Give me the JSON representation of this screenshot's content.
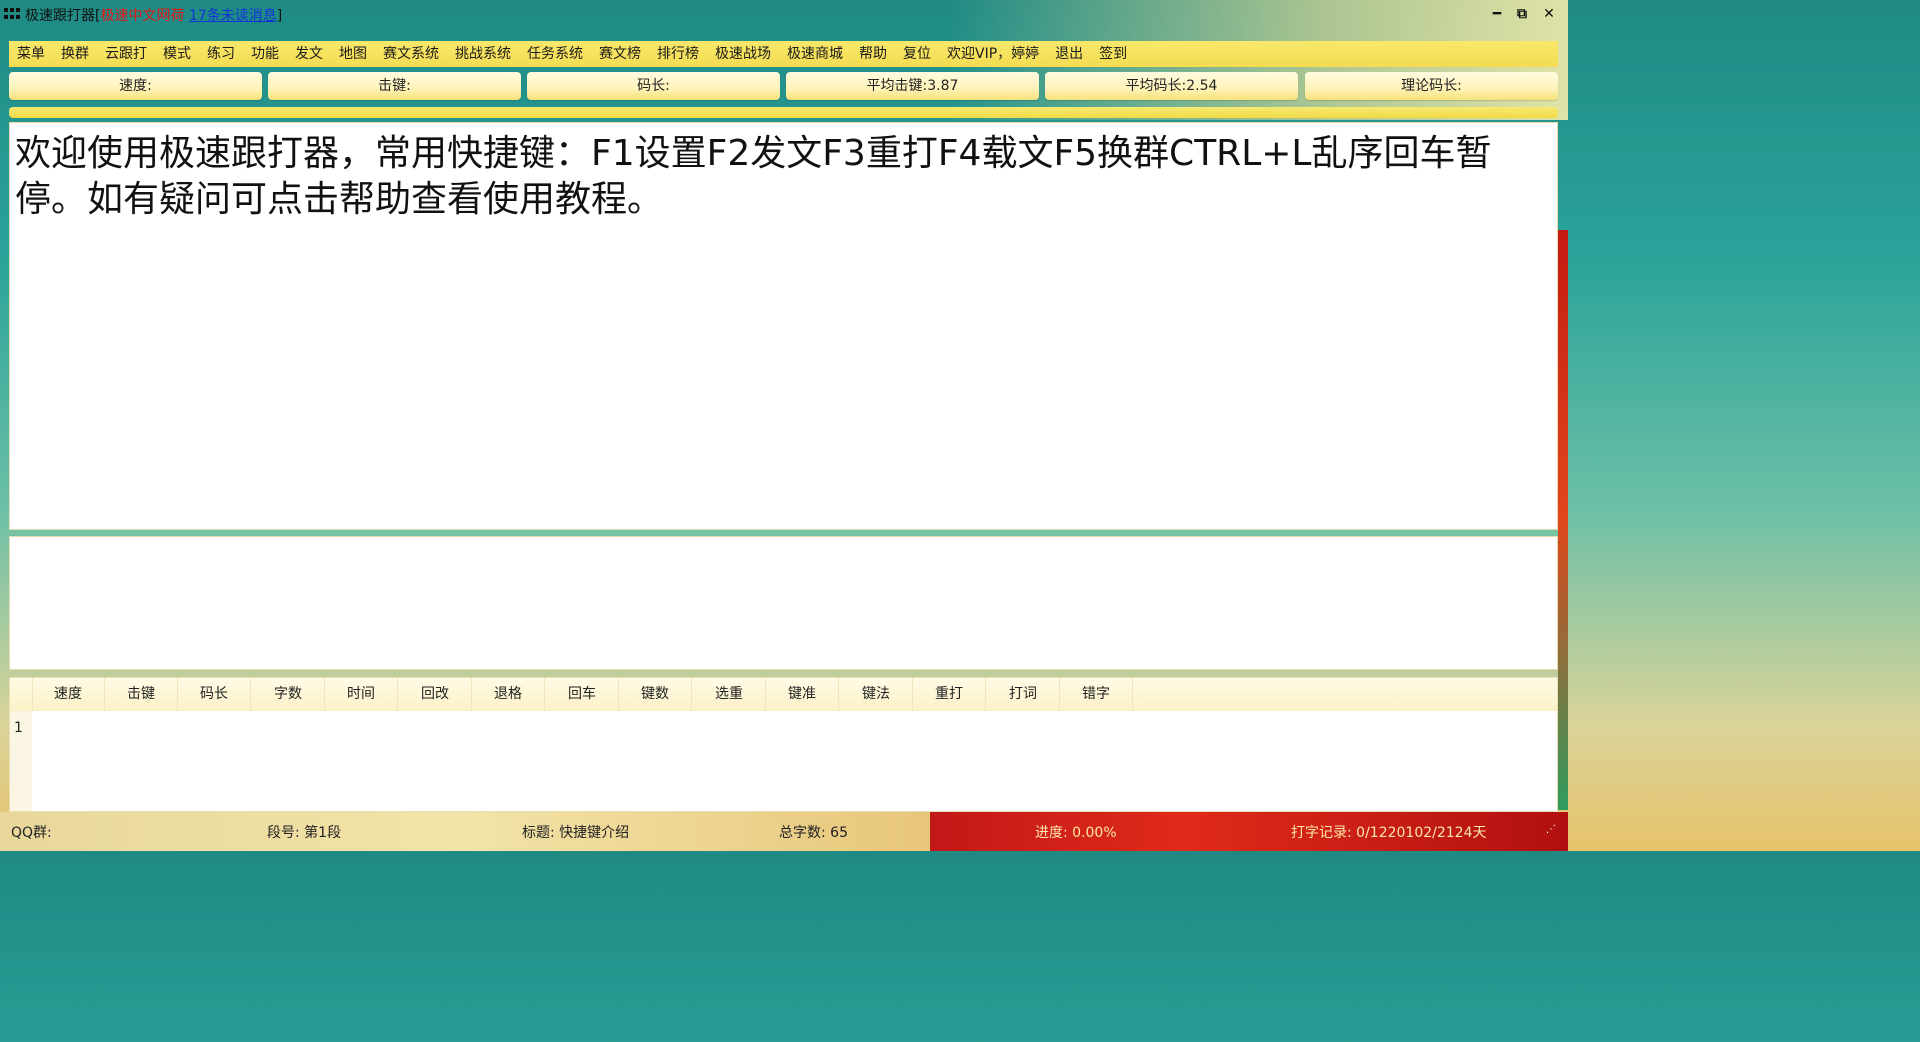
{
  "window": {
    "app_name": "极速跟打器[",
    "site_name": "极速中文网荷",
    "unread_link": "17条未读消息",
    "close_bracket": "]",
    "minimize_glyph": "━",
    "restore_glyph": "⧉",
    "close_glyph": "✕"
  },
  "menu": {
    "items": [
      "菜单",
      "换群",
      "云跟打",
      "模式",
      "练习",
      "功能",
      "发文",
      "地图",
      "赛文系统",
      "挑战系统",
      "任务系统",
      "赛文榜",
      "排行榜",
      "极速战场",
      "极速商城",
      "帮助",
      "复位",
      "欢迎VIP，婷婷",
      "退出",
      "签到"
    ]
  },
  "stats": {
    "speed": "速度:",
    "keystroke": "击键:",
    "code_length": "码长:",
    "avg_keystroke": "平均击键:3.87",
    "avg_code_length": "平均码长:2.54",
    "theory_code_length": "理论码长:"
  },
  "text_panel": {
    "content": "欢迎使用极速跟打器，常用快捷键：F1设置F2发文F3重打F4载文F5换群CTRL+L乱序回车暂停。如有疑问可点击帮助查看使用教程。"
  },
  "input_panel": {
    "value": ""
  },
  "results_table": {
    "columns": [
      "速度",
      "击键",
      "码长",
      "字数",
      "时间",
      "回改",
      "退格",
      "回车",
      "键数",
      "选重",
      "键准",
      "键法",
      "重打",
      "打词",
      "错字"
    ],
    "rows": [
      "1"
    ]
  },
  "status": {
    "qq_group": "QQ群:",
    "segment": "段号: 第1段",
    "title": "标题: 快捷键介绍",
    "total_chars": "总字数: 65",
    "progress": "进度: 0.00%",
    "record": "打字记录: 0/1220102/2124天"
  },
  "colors": {
    "menu_bg": "#f6e15c",
    "stat_bg": "#fff3b8",
    "title_red": "#e01818",
    "link_blue": "#1234d6"
  },
  "icons": [
    "app-grid-icon",
    "minimize-icon",
    "restore-icon",
    "close-icon",
    "resize-grip-icon"
  ]
}
